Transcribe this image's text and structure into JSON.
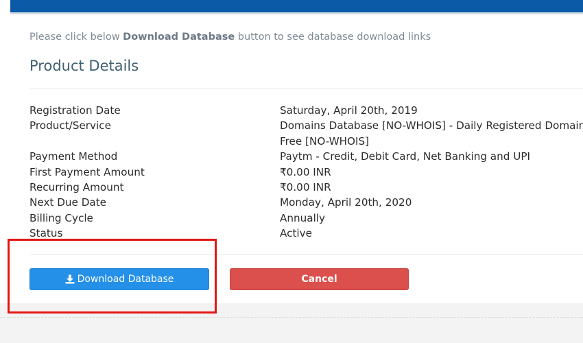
{
  "intro": {
    "before": "Please click below ",
    "bold": "Download Database",
    "after": " button to see database download links"
  },
  "title": "Product Details",
  "details": [
    {
      "label": "Registration Date",
      "value": "Saturday, April 20th, 2019"
    },
    {
      "label": "Product/Service",
      "value": "Domains Database [NO-WHOIS] - Daily Registered Domains",
      "value2": "Free [NO-WHOIS]"
    },
    {
      "label": "Payment Method",
      "value": "Paytm - Credit, Debit Card, Net Banking and UPI"
    },
    {
      "label": "First Payment Amount",
      "value": "₹0.00 INR"
    },
    {
      "label": "Recurring Amount",
      "value": "₹0.00 INR"
    },
    {
      "label": "Next Due Date",
      "value": "Monday, April 20th, 2020"
    },
    {
      "label": "Billing Cycle",
      "value": "Annually"
    },
    {
      "label": "Status",
      "value": "Active"
    }
  ],
  "buttons": {
    "download_label": "Download Database",
    "download_icon": "download-icon",
    "cancel_label": "Cancel"
  },
  "colors": {
    "header_bar": "#0a5aa7",
    "download_button": "#2490e8",
    "cancel_button": "#db4f4c",
    "highlight": "#e31414",
    "title": "#3f6074"
  }
}
